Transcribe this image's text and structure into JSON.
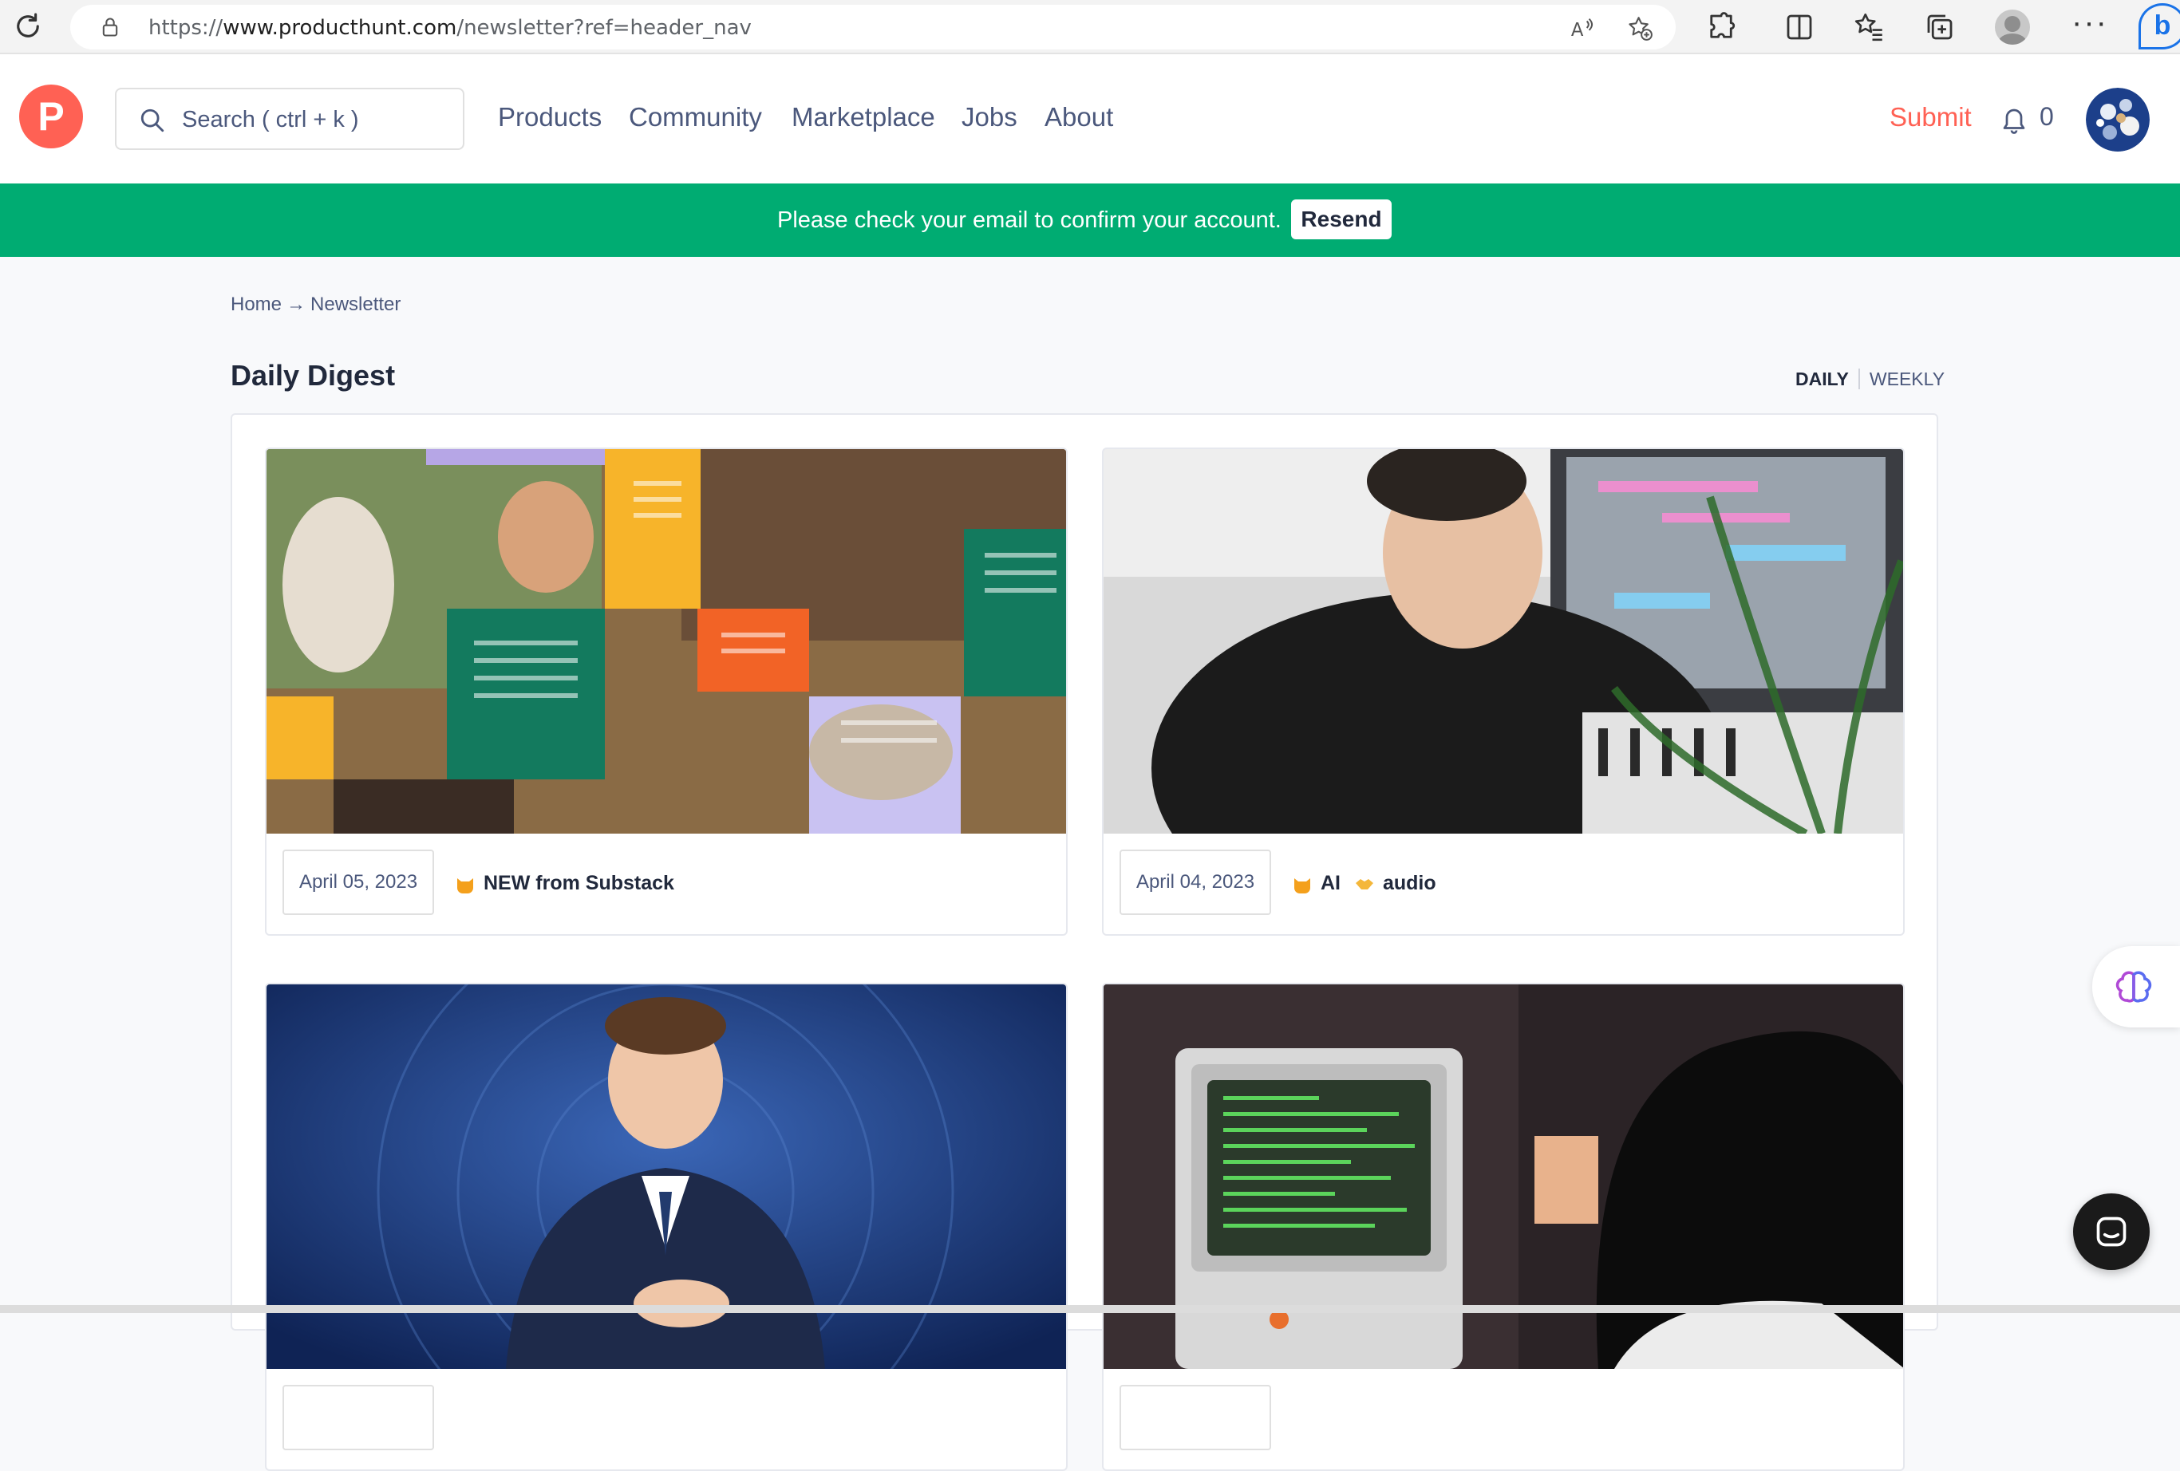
{
  "browser": {
    "url_prefix": "https://",
    "url_domain": "www.producthunt.com",
    "url_path": "/newsletter?ref=header_nav"
  },
  "header": {
    "logo_letter": "P",
    "search_placeholder": "Search ( ctrl + k )",
    "nav": [
      "Products",
      "Community",
      "Marketplace",
      "Jobs",
      "About"
    ],
    "submit_label": "Submit",
    "notification_count": "0"
  },
  "banner": {
    "message": "Please check your email to confirm your account.",
    "resend_label": "Resend",
    "color": "#00ac72"
  },
  "breadcrumb": {
    "home": "Home",
    "separator": "→",
    "current": "Newsletter"
  },
  "digest": {
    "title": "Daily Digest",
    "tab_daily": "DAILY",
    "tab_weekly": "WEEKLY"
  },
  "cards": [
    {
      "date": "April 05, 2023",
      "title": "NEW from Substack"
    },
    {
      "date": "April 04, 2023",
      "title_part1": "AI",
      "title_part2": "audio"
    },
    {
      "date": ""
    },
    {
      "date": ""
    }
  ],
  "colors": {
    "brand": "#ff6154",
    "text_primary": "#21293c",
    "text_secondary": "#4b587c"
  }
}
